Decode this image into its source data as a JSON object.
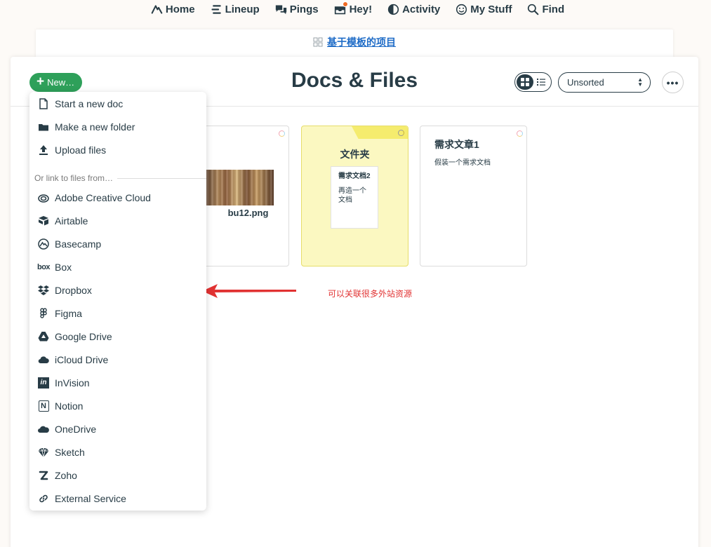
{
  "nav": {
    "items": [
      {
        "label": "Home",
        "icon": "basecamp-home-icon"
      },
      {
        "label": "Lineup",
        "icon": "lineup-icon"
      },
      {
        "label": "Pings",
        "icon": "pings-icon"
      },
      {
        "label": "Hey!",
        "icon": "hey-inbox-icon"
      },
      {
        "label": "Activity",
        "icon": "activity-icon"
      },
      {
        "label": "My Stuff",
        "icon": "smiley-icon"
      },
      {
        "label": "Find",
        "icon": "search-icon"
      }
    ]
  },
  "breadcrumb": {
    "project_link": "基于模板的项目"
  },
  "header": {
    "new_button": "New…",
    "title": "Docs & Files",
    "sort": "Unsorted"
  },
  "cards": {
    "image_file": {
      "name": "bu12.png"
    },
    "folder": {
      "title": "文件夹",
      "doc_title": "需求文档2",
      "doc_body": "再造一个文档"
    },
    "doc": {
      "title": "需求文章1",
      "body": "假装一个需求文档"
    }
  },
  "menu": {
    "items": [
      {
        "label": "Start a new doc",
        "icon": "document-icon"
      },
      {
        "label": "Make a new folder",
        "icon": "folder-icon"
      },
      {
        "label": "Upload files",
        "icon": "upload-icon"
      }
    ],
    "section_label": "Or link to files from…",
    "services": [
      {
        "label": "Adobe Creative Cloud",
        "icon": "adobe-creative-cloud-icon"
      },
      {
        "label": "Airtable",
        "icon": "airtable-icon"
      },
      {
        "label": "Basecamp",
        "icon": "basecamp-icon"
      },
      {
        "label": "Box",
        "icon": "box-icon"
      },
      {
        "label": "Dropbox",
        "icon": "dropbox-icon"
      },
      {
        "label": "Figma",
        "icon": "figma-icon"
      },
      {
        "label": "Google Drive",
        "icon": "google-drive-icon"
      },
      {
        "label": "iCloud Drive",
        "icon": "icloud-icon"
      },
      {
        "label": "InVision",
        "icon": "invision-icon"
      },
      {
        "label": "Notion",
        "icon": "notion-icon"
      },
      {
        "label": "OneDrive",
        "icon": "onedrive-icon"
      },
      {
        "label": "Sketch",
        "icon": "sketch-icon"
      },
      {
        "label": "Zoho",
        "icon": "zoho-icon"
      },
      {
        "label": "External Service",
        "icon": "link-icon"
      }
    ]
  },
  "annotation": {
    "text": "可以关联很多外站资源",
    "color": "#e13232"
  },
  "colors": {
    "accent_green": "#2ea05a",
    "text_dark": "#283c46",
    "link_blue": "#1f6cc7",
    "folder_yellow": "#fbf8c1"
  },
  "box_logo_text": "box",
  "invision_logo_text": "in",
  "notion_logo_text": "N"
}
